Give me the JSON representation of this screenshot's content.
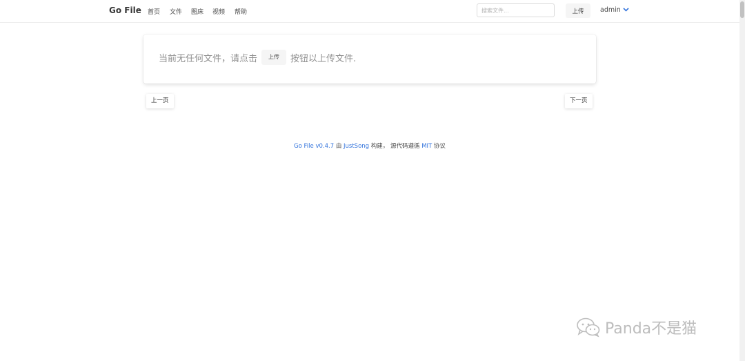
{
  "navbar": {
    "brand": "Go File",
    "items": [
      {
        "label": "首页"
      },
      {
        "label": "文件"
      },
      {
        "label": "图床"
      },
      {
        "label": "视频"
      },
      {
        "label": "帮助"
      }
    ],
    "search_placeholder": "搜索文件...",
    "upload_label": "上传",
    "user_label": "admin"
  },
  "notice": {
    "prefix": "当前无任何文件，请点击",
    "button_label": "上传",
    "suffix": "按钮以上传文件."
  },
  "pagination": {
    "prev_label": "上一页",
    "next_label": "下一页"
  },
  "footer": {
    "app_link": "Go File v0.4.7",
    "by": " 由 ",
    "author_link": "JustSong",
    "built": " 构建， 源代码遵循 ",
    "license_link": "MIT",
    "license_suffix": " 协议"
  },
  "watermark": {
    "text": "Panda不是猫",
    "icon": "wechat-icon"
  },
  "colors": {
    "link": "#3273dc",
    "button_bg": "#f5f5f5",
    "notice_text": "#8f8f8f"
  }
}
